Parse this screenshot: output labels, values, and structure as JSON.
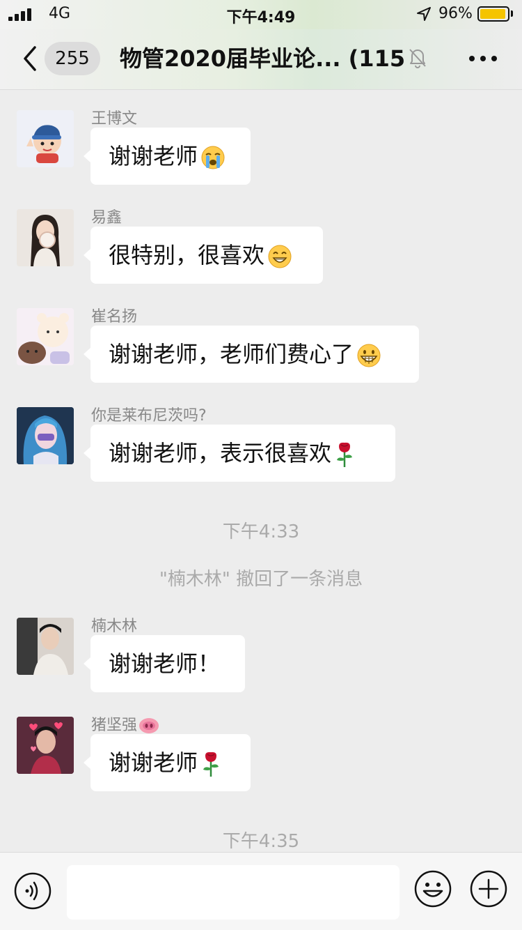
{
  "status_bar": {
    "network": "4G",
    "time": "下午4:49",
    "battery_percent": "96%",
    "battery_level": 0.96,
    "icons": [
      "signal-icon",
      "location-arrow-icon",
      "battery-icon"
    ]
  },
  "nav": {
    "back_count": "255",
    "title": "物管2020届毕业论... (115)",
    "icons": [
      "back-chevron-icon",
      "mute-bell-icon",
      "more-dots-icon"
    ]
  },
  "messages": [
    {
      "sender": "王博文",
      "text": "谢谢老师",
      "emoji": "crying-emoji"
    },
    {
      "sender": "易鑫",
      "text": "很特别，很喜欢",
      "emoji": "grin-emoji"
    },
    {
      "sender": "崔名扬",
      "text": "谢谢老师，老师们费心了",
      "emoji": "big-grin-emoji"
    },
    {
      "sender": "你是莱布尼茨吗?",
      "text": "谢谢老师，表示很喜欢",
      "emoji": "rose-emoji"
    }
  ],
  "time_labels": [
    "下午4:33",
    "下午4:35"
  ],
  "system_message": "\"楠木林\" 撤回了一条消息",
  "messages_after": [
    {
      "sender": "楠木林",
      "text": "谢谢老师！"
    },
    {
      "sender": "猪坚强",
      "sender_emoji": "pig-nose-emoji",
      "text": "谢谢老师",
      "emoji": "rose-emoji"
    }
  ],
  "input_bar": {
    "placeholder": "",
    "icons": [
      "voice-icon",
      "emoji-face-icon",
      "plus-icon"
    ]
  },
  "colors": {
    "background": "#ededed",
    "bubble": "#ffffff",
    "muted_text": "#888888",
    "battery": "#f5c400"
  }
}
